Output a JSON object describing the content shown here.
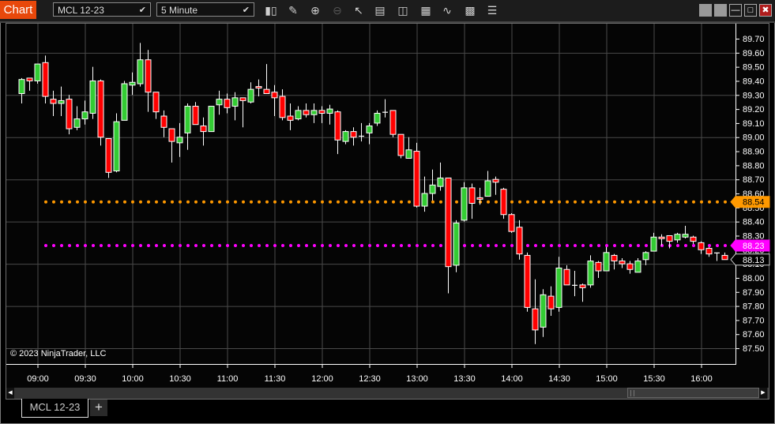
{
  "toolbar": {
    "app_title": "Chart",
    "instrument": "MCL 12-23",
    "interval": "5 Minute",
    "icons": [
      "bar-type-icon",
      "pencil-draw-icon",
      "zoom-in-icon",
      "zoom-out-icon",
      "pointer-icon",
      "data-box-icon",
      "chart-trader-icon",
      "properties-icon",
      "indicators-icon",
      "strategies-icon",
      "templates-list-icon"
    ],
    "window_buttons": [
      "tile-button",
      "tile-button-2",
      "minimize",
      "maximize",
      "close"
    ]
  },
  "colors": {
    "up": "#33cc33",
    "down": "#ff0000",
    "line_orange": "#ff9900",
    "line_magenta": "#ff00ff",
    "background": "#050505",
    "grid": "#4a4a4a"
  },
  "copyright": "© 2023 NinjaTrader, LLC",
  "tabs": [
    {
      "label": "MCL 12-23",
      "active": true
    }
  ],
  "add_tab_label": "+",
  "scrollbar": {
    "position_fraction": 0.84
  },
  "chart_data": {
    "type": "candlestick",
    "interval": "5 Minute",
    "ylim": [
      87.45,
      89.75
    ],
    "y_ticks": [
      "89.70",
      "89.60",
      "89.50",
      "89.40",
      "89.30",
      "89.20",
      "89.10",
      "89.00",
      "88.90",
      "88.80",
      "88.70",
      "88.60",
      "88.50",
      "88.40",
      "88.30",
      "88.20",
      "88.10",
      "88.00",
      "87.90",
      "87.80",
      "87.70",
      "87.60",
      "87.50"
    ],
    "x_ticks": [
      "09:00",
      "09:30",
      "10:00",
      "10:30",
      "11:00",
      "11:30",
      "12:00",
      "12:30",
      "13:00",
      "13:30",
      "14:00",
      "14:30",
      "15:00",
      "15:30",
      "16:00"
    ],
    "grid": true,
    "first_bar_time": "08:50",
    "horizontal_lines": [
      {
        "price": 88.54,
        "label": "88.54",
        "color": "#ff9900"
      },
      {
        "price": 88.23,
        "label": "88.23",
        "color": "#ff00ff"
      }
    ],
    "last_price": {
      "price": 88.13,
      "label": "88.13"
    },
    "ohlc": [
      [
        89.31,
        89.42,
        89.24,
        89.41
      ],
      [
        89.42,
        89.42,
        89.33,
        89.4
      ],
      [
        89.4,
        89.52,
        89.38,
        89.52
      ],
      [
        89.53,
        89.58,
        89.24,
        89.29
      ],
      [
        89.27,
        89.33,
        89.15,
        89.24
      ],
      [
        89.24,
        89.36,
        89.15,
        89.26
      ],
      [
        89.27,
        89.3,
        89.02,
        89.06
      ],
      [
        89.07,
        89.22,
        89.05,
        89.13
      ],
      [
        89.13,
        89.26,
        89.09,
        89.18
      ],
      [
        89.17,
        89.5,
        89.13,
        89.4
      ],
      [
        89.4,
        89.41,
        88.94,
        89.0
      ],
      [
        88.99,
        88.99,
        88.71,
        88.75
      ],
      [
        88.76,
        89.17,
        88.75,
        89.11
      ],
      [
        89.12,
        89.4,
        89.12,
        89.38
      ],
      [
        89.37,
        89.46,
        89.3,
        89.39
      ],
      [
        89.38,
        89.67,
        89.36,
        89.55
      ],
      [
        89.55,
        89.62,
        89.18,
        89.32
      ],
      [
        89.32,
        89.32,
        89.13,
        89.18
      ],
      [
        89.15,
        89.19,
        89.0,
        89.07
      ],
      [
        89.06,
        89.06,
        88.82,
        88.97
      ],
      [
        88.96,
        89.1,
        88.86,
        89.0
      ],
      [
        89.03,
        89.24,
        88.91,
        89.22
      ],
      [
        89.22,
        89.25,
        89.09,
        89.09
      ],
      [
        89.08,
        89.14,
        88.94,
        89.04
      ],
      [
        89.04,
        89.22,
        89.04,
        89.22
      ],
      [
        89.23,
        89.33,
        89.16,
        89.27
      ],
      [
        89.27,
        89.31,
        89.17,
        89.21
      ],
      [
        89.22,
        89.32,
        89.12,
        89.28
      ],
      [
        89.28,
        89.28,
        89.07,
        89.26
      ],
      [
        89.25,
        89.39,
        89.24,
        89.34
      ],
      [
        89.36,
        89.41,
        89.29,
        89.35
      ],
      [
        89.34,
        89.52,
        89.31,
        89.31
      ],
      [
        89.32,
        89.37,
        89.15,
        89.28
      ],
      [
        89.29,
        89.34,
        89.12,
        89.14
      ],
      [
        89.15,
        89.24,
        89.05,
        89.12
      ],
      [
        89.13,
        89.22,
        89.12,
        89.19
      ],
      [
        89.19,
        89.24,
        89.14,
        89.16
      ],
      [
        89.16,
        89.24,
        89.1,
        89.19
      ],
      [
        89.19,
        89.22,
        89.1,
        89.17
      ],
      [
        89.17,
        89.23,
        89.09,
        89.2
      ],
      [
        89.18,
        89.19,
        88.88,
        88.98
      ],
      [
        88.97,
        89.05,
        88.95,
        89.04
      ],
      [
        89.04,
        89.07,
        88.94,
        89.0
      ],
      [
        89.01,
        89.1,
        88.97,
        89.01
      ],
      [
        89.03,
        89.1,
        88.95,
        89.08
      ],
      [
        89.1,
        89.19,
        89.08,
        89.17
      ],
      [
        89.18,
        89.27,
        89.14,
        89.18
      ],
      [
        89.19,
        89.19,
        89.0,
        89.02
      ],
      [
        89.02,
        89.02,
        88.85,
        88.87
      ],
      [
        88.85,
        89.0,
        88.85,
        88.91
      ],
      [
        88.9,
        88.96,
        88.5,
        88.51
      ],
      [
        88.51,
        88.72,
        88.47,
        88.6
      ],
      [
        88.6,
        88.77,
        88.55,
        88.66
      ],
      [
        88.65,
        88.82,
        88.62,
        88.71
      ],
      [
        88.71,
        88.71,
        87.89,
        88.08
      ],
      [
        88.09,
        88.41,
        88.04,
        88.39
      ],
      [
        88.41,
        88.68,
        88.4,
        88.64
      ],
      [
        88.64,
        88.67,
        88.42,
        88.53
      ],
      [
        88.57,
        88.64,
        88.52,
        88.56
      ],
      [
        88.58,
        88.76,
        88.58,
        88.69
      ],
      [
        88.7,
        88.72,
        88.59,
        88.68
      ],
      [
        88.63,
        88.64,
        88.42,
        88.45
      ],
      [
        88.45,
        88.46,
        88.32,
        88.33
      ],
      [
        88.36,
        88.41,
        88.13,
        88.17
      ],
      [
        88.16,
        88.18,
        87.76,
        87.79
      ],
      [
        87.78,
        87.99,
        87.53,
        87.63
      ],
      [
        87.65,
        87.92,
        87.58,
        87.88
      ],
      [
        87.87,
        87.94,
        87.73,
        87.78
      ],
      [
        87.79,
        88.15,
        87.76,
        88.07
      ],
      [
        88.06,
        88.09,
        87.95,
        87.95
      ],
      [
        87.95,
        88.05,
        87.87,
        87.95
      ],
      [
        87.95,
        87.96,
        87.83,
        87.93
      ],
      [
        87.95,
        88.16,
        87.93,
        88.12
      ],
      [
        88.11,
        88.12,
        88.0,
        88.05
      ],
      [
        88.05,
        88.22,
        88.05,
        88.18
      ],
      [
        88.16,
        88.17,
        88.06,
        88.12
      ],
      [
        88.12,
        88.14,
        88.07,
        88.1
      ],
      [
        88.1,
        88.12,
        88.03,
        88.06
      ],
      [
        88.04,
        88.14,
        88.04,
        88.12
      ],
      [
        88.13,
        88.19,
        88.09,
        88.18
      ],
      [
        88.19,
        88.32,
        88.19,
        88.29
      ],
      [
        88.29,
        88.31,
        88.23,
        88.28
      ],
      [
        88.3,
        88.3,
        88.21,
        88.26
      ],
      [
        88.27,
        88.32,
        88.25,
        88.31
      ],
      [
        88.29,
        88.37,
        88.28,
        88.31
      ],
      [
        88.29,
        88.3,
        88.24,
        88.26
      ],
      [
        88.25,
        88.26,
        88.17,
        88.2
      ],
      [
        88.21,
        88.22,
        88.15,
        88.17
      ],
      [
        88.18,
        88.18,
        88.12,
        88.18
      ],
      [
        88.16,
        88.18,
        88.13,
        88.13
      ]
    ]
  }
}
